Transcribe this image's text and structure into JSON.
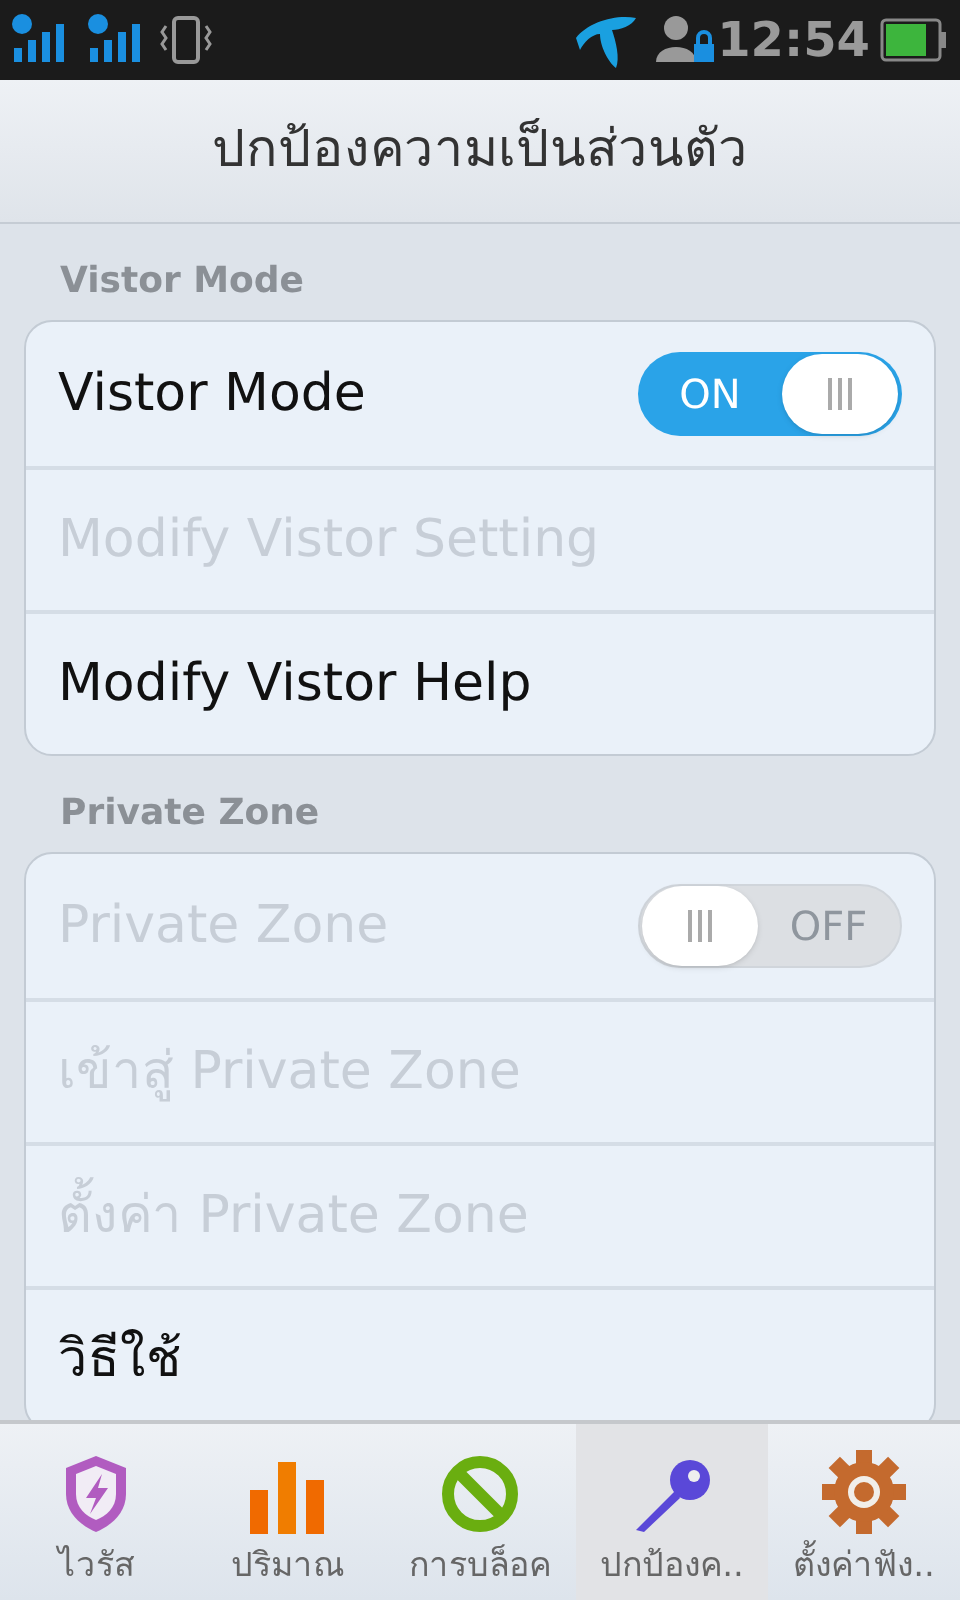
{
  "status_bar": {
    "time": "12:54"
  },
  "title": "ปกป้องความเป็นส่วนตัว",
  "sections": [
    {
      "header": "Vistor Mode",
      "items": [
        {
          "kind": "toggle",
          "label": "Vistor Mode",
          "disabled": false,
          "on": true,
          "toggle_text": "ON"
        },
        {
          "kind": "link",
          "label": "Modify Vistor Setting",
          "disabled": true
        },
        {
          "kind": "link",
          "label": "Modify Vistor Help",
          "disabled": false
        }
      ]
    },
    {
      "header": "Private Zone",
      "items": [
        {
          "kind": "toggle",
          "label": "Private Zone",
          "disabled": true,
          "on": false,
          "toggle_text": "OFF"
        },
        {
          "kind": "link",
          "label": "เข้าสู่ Private Zone",
          "disabled": true
        },
        {
          "kind": "link",
          "label": "ตั้งค่า Private Zone",
          "disabled": true
        },
        {
          "kind": "link",
          "label": "วิธีใช้",
          "disabled": false
        }
      ]
    }
  ],
  "tabs": [
    {
      "kind": "virus",
      "label": "ไวรัส",
      "selected": false
    },
    {
      "kind": "usage",
      "label": "ปริมาณ",
      "selected": false
    },
    {
      "kind": "block",
      "label": "การบล็อค",
      "selected": false
    },
    {
      "kind": "privacy",
      "label": "ปกป้องค..",
      "selected": true
    },
    {
      "kind": "settings",
      "label": "ตั้งค่าฟัง..",
      "selected": false
    }
  ]
}
